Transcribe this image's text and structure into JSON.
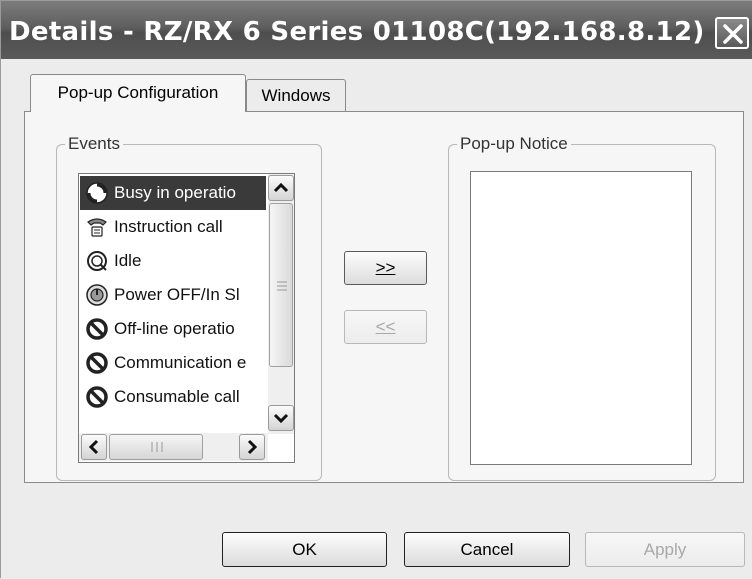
{
  "window": {
    "title": "Details - RZ/RX 6 Series 01108C(192.168.8.12)"
  },
  "tabs": [
    {
      "label": "Pop-up Configuration",
      "active": true
    },
    {
      "label": "Windows",
      "active": false
    }
  ],
  "events": {
    "group_label": "Events",
    "items": [
      {
        "label": "Busy in operatio",
        "icon": "busy-icon",
        "selected": true
      },
      {
        "label": "Instruction call",
        "icon": "instruction-call-icon",
        "selected": false
      },
      {
        "label": "Idle",
        "icon": "idle-icon",
        "selected": false
      },
      {
        "label": "Power OFF/In Sl",
        "icon": "power-off-icon",
        "selected": false
      },
      {
        "label": "Off-line operatio",
        "icon": "no-symbol-icon",
        "selected": false
      },
      {
        "label": "Communication e",
        "icon": "no-symbol-icon",
        "selected": false
      },
      {
        "label": "Consumable call",
        "icon": "no-symbol-icon",
        "selected": false
      }
    ]
  },
  "transfer": {
    "add_label": ">>",
    "remove_label": "<<"
  },
  "notice": {
    "group_label": "Pop-up Notice"
  },
  "footer": {
    "ok_label": "OK",
    "cancel_label": "Cancel",
    "apply_label": "Apply"
  }
}
